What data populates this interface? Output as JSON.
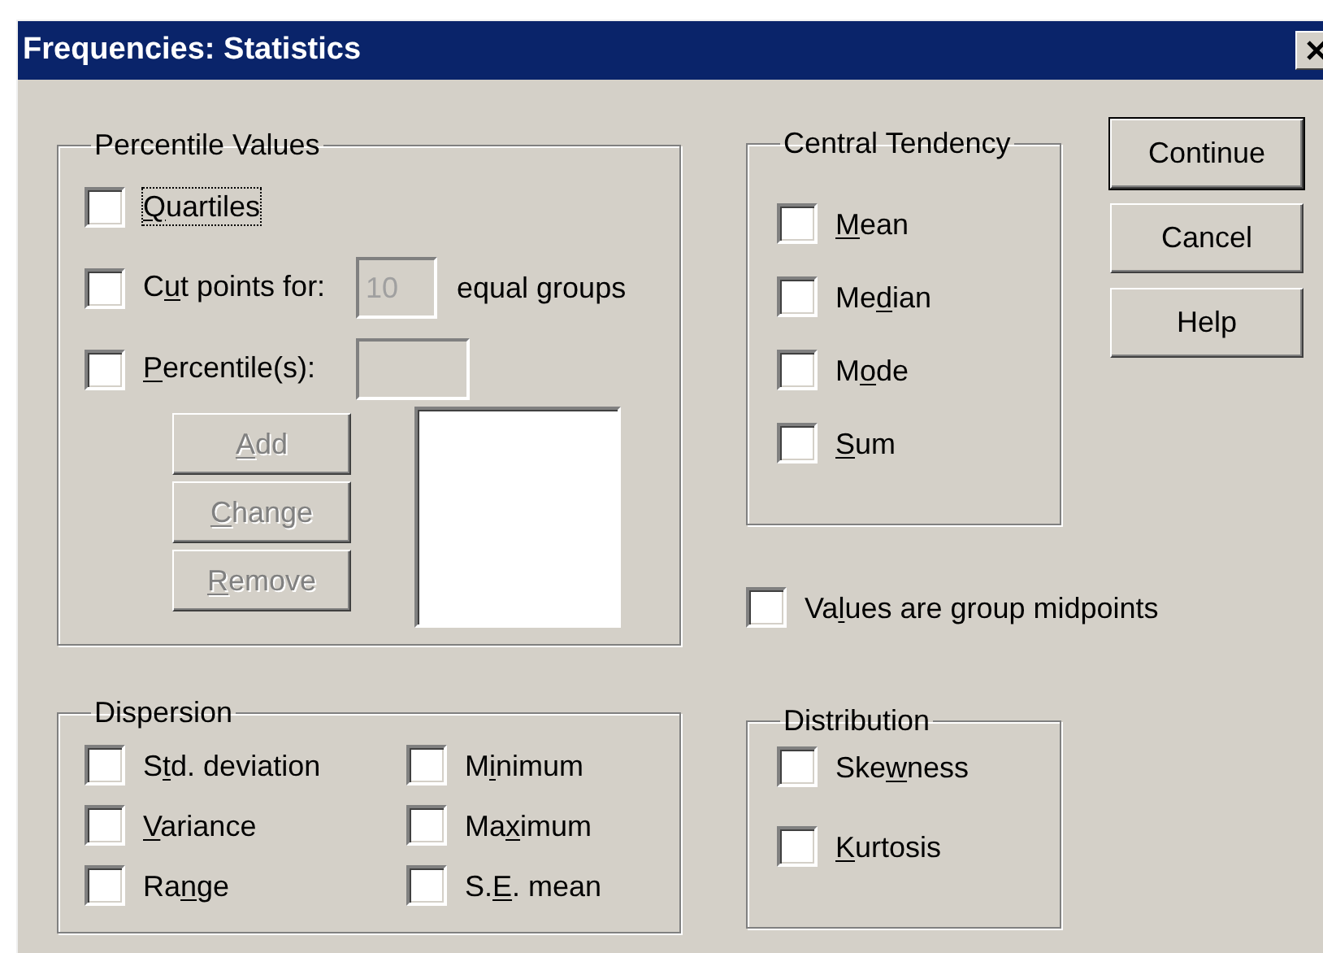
{
  "window": {
    "title": "Frequencies: Statistics"
  },
  "percentile_values": {
    "title": "Percentile Values",
    "options": [
      {
        "kind": "checkbox",
        "label": {
          "key": "Q",
          "after": "uartiles"
        },
        "checked": false,
        "focused": true
      },
      {
        "kind": "checkbox_field",
        "label": {
          "before": "C",
          "key": "u",
          "after": "t points for:"
        },
        "checked": false,
        "focused": false,
        "field": {
          "value": "10",
          "disabled": true
        },
        "suffix": "equal groups"
      },
      {
        "kind": "checkbox_field",
        "label": {
          "key": "P",
          "after": "ercentile(s):"
        },
        "checked": false,
        "focused": false,
        "field": {
          "disabled": true
        }
      }
    ],
    "buttons": [
      {
        "label": {
          "key": "A",
          "after": "dd"
        },
        "disabled": true
      },
      {
        "label": {
          "key": "C",
          "after": "hange"
        },
        "disabled": true
      },
      {
        "label": {
          "key": "R",
          "after": "emove"
        },
        "disabled": true
      }
    ]
  },
  "central_tendency": {
    "title": "Central Tendency",
    "options": [
      {
        "label": {
          "key": "M",
          "after": "ean"
        },
        "checked": false
      },
      {
        "label": {
          "before": "Me",
          "key": "d",
          "after": "ian"
        },
        "checked": false
      },
      {
        "label": {
          "before": "M",
          "key": "o",
          "after": "de"
        },
        "checked": false
      },
      {
        "label": {
          "key": "S",
          "after": "um"
        },
        "checked": false
      }
    ]
  },
  "dialog_buttons": [
    {
      "label": "Continue",
      "default": true
    },
    {
      "label": "Cancel",
      "default": false
    },
    {
      "label": "Help",
      "default": false
    }
  ],
  "group_midpoints": {
    "label": {
      "before": "Va",
      "key": "l",
      "after": "ues are group midpoints"
    },
    "checked": false
  },
  "dispersion": {
    "title": "Dispersion",
    "options": [
      {
        "label": {
          "before": "S",
          "key": "t",
          "after": "d. deviation"
        },
        "checked": false
      },
      {
        "label": {
          "before": "M",
          "key": "i",
          "after": "nimum"
        },
        "checked": false
      },
      {
        "label": {
          "key": "V",
          "after": "ariance"
        },
        "checked": false
      },
      {
        "label": {
          "before": "Ma",
          "key": "x",
          "after": "imum"
        },
        "checked": false
      },
      {
        "label": {
          "before": "Ra",
          "key": "n",
          "after": "ge"
        },
        "checked": false
      },
      {
        "label": {
          "before": "S.",
          "key": "E",
          "after": ". mean"
        },
        "checked": false
      }
    ]
  },
  "distribution": {
    "title": "Distribution",
    "options": [
      {
        "label": {
          "before": "Ske",
          "key": "w",
          "after": "ness"
        },
        "checked": false
      },
      {
        "label": {
          "key": "K",
          "after": "urtosis"
        },
        "checked": false
      }
    ]
  }
}
